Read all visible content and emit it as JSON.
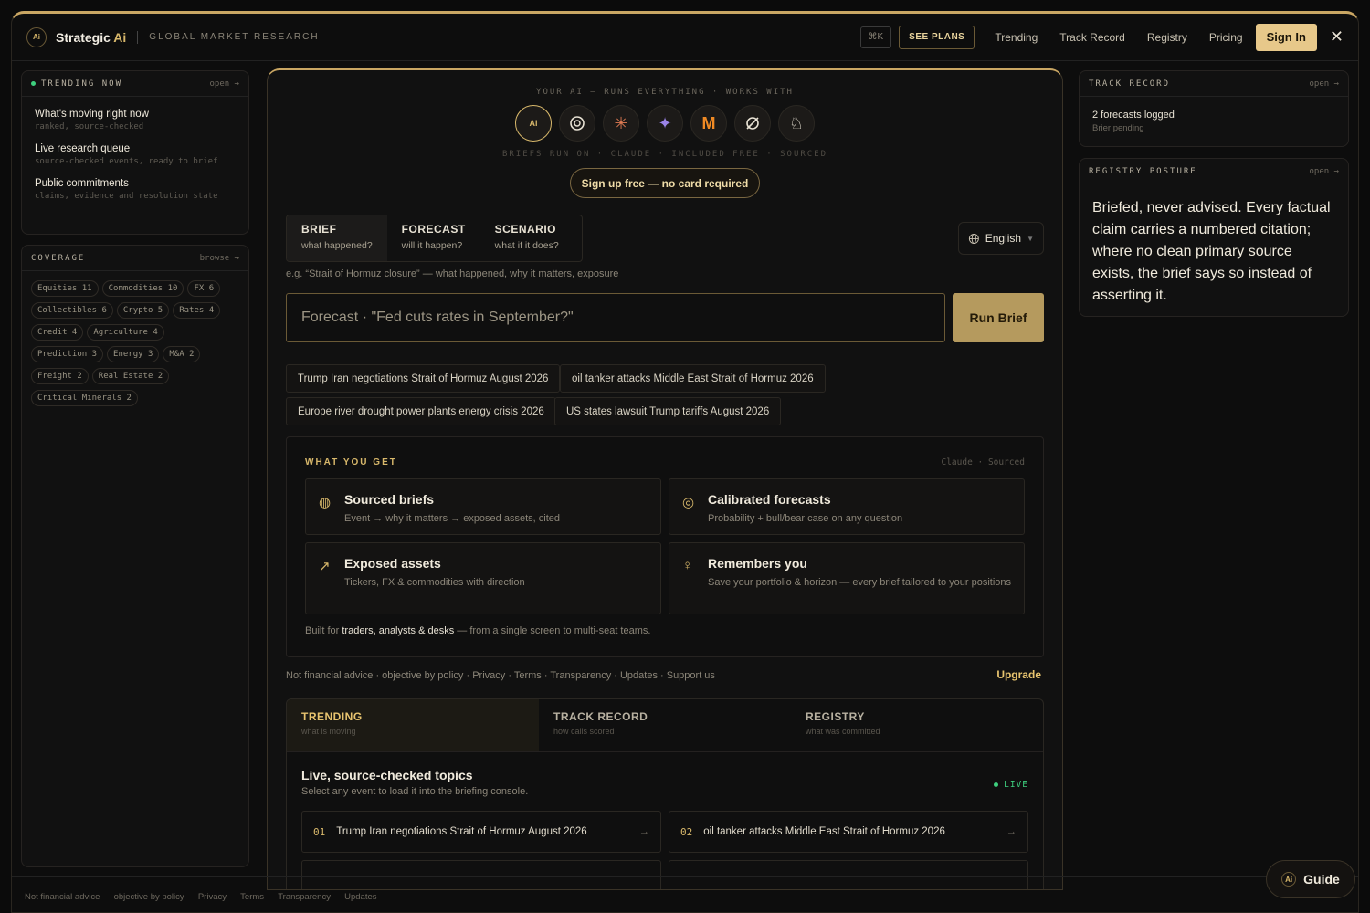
{
  "header": {
    "logo_text": "Ai",
    "brand_name": "Strategic",
    "brand_ai": "Ai",
    "tagline": "GLOBAL MARKET RESEARCH",
    "kbd": "⌘K",
    "see_plans": "SEE PLANS",
    "nav": [
      "Trending",
      "Track Record",
      "Registry",
      "Pricing"
    ],
    "sign_in": "Sign In",
    "close_icon": "close-icon"
  },
  "trending_now": {
    "title": "TRENDING NOW",
    "action": "open →",
    "items": [
      {
        "title": "What's moving right now",
        "sub": "ranked, source-checked"
      },
      {
        "title": "Live research queue",
        "sub": "source-checked events, ready to brief"
      },
      {
        "title": "Public commitments",
        "sub": "claims, evidence and resolution state"
      }
    ]
  },
  "coverage": {
    "title": "COVERAGE",
    "action": "browse →",
    "chips": [
      "Equities 11",
      "Commodities 10",
      "FX 6",
      "Collectibles 6",
      "Crypto 5",
      "Rates 4",
      "Credit 4",
      "Agriculture 4",
      "Prediction 3",
      "Energy 3",
      "M&A 2",
      "Freight 2",
      "Real Estate 2",
      "Critical Minerals 2"
    ]
  },
  "console": {
    "works_with": "YOUR AI — RUNS EVERYTHING · WORKS WITH",
    "model_icons": [
      "strategic-ai-icon",
      "openai-icon",
      "claude-icon",
      "gemini-icon",
      "mistral-icon",
      "grok-icon",
      "llama-icon"
    ],
    "runs_on": "BRIEFS RUN ON · CLAUDE · INCLUDED FREE · SOURCED",
    "signup": "Sign up free — no card required",
    "modes": [
      {
        "title": "BRIEF",
        "sub": "what happened?"
      },
      {
        "title": "FORECAST",
        "sub": "will it happen?"
      },
      {
        "title": "SCENARIO",
        "sub": "what if it does?"
      }
    ],
    "language": "English",
    "hint": "e.g. “Strait of Hormuz closure” — what happened, why it matters, exposure",
    "query_placeholder": "Forecast · \"Fed cuts rates in September?\"",
    "run_button": "Run Brief",
    "suggestions": [
      "Trump Iran negotiations Strait of Hormuz August 2026",
      "oil tanker attacks Middle East Strait of Hormuz 2026",
      "Europe river drought power plants energy crisis 2026",
      "US states lawsuit Trump tariffs August 2026"
    ]
  },
  "what_you_get": {
    "title": "WHAT YOU GET",
    "right": "Claude · Sourced",
    "features": [
      {
        "icon": "brain-icon",
        "title": "Sourced briefs",
        "sub": "Event → why it matters → exposed assets, cited"
      },
      {
        "icon": "target-icon",
        "title": "Calibrated forecasts",
        "sub": "Probability + bull/bear case on any question"
      },
      {
        "icon": "trend-up-icon",
        "title": "Exposed assets",
        "sub": "Tickers, FX & commodities with direction"
      },
      {
        "icon": "lightbulb-icon",
        "title": "Remembers you",
        "sub": "Save your portfolio & horizon — every brief tailored to your positions"
      }
    ],
    "built_prefix": "Built for ",
    "built_bold": "traders, analysts & desks",
    "built_suffix": " — from a single screen to multi-seat teams."
  },
  "footer_links": "Not financial advice · objective by policy · Privacy · Terms · Transparency · Updates · Support us",
  "upgrade": "Upgrade",
  "bottom_tabs": [
    {
      "title": "TRENDING",
      "sub": "what is moving"
    },
    {
      "title": "TRACK RECORD",
      "sub": "how calls scored"
    },
    {
      "title": "REGISTRY",
      "sub": "what was committed"
    }
  ],
  "live": {
    "title": "Live, source-checked topics",
    "sub": "Select any event to load it into the briefing console.",
    "badge": "LIVE",
    "rows": [
      {
        "num": "01",
        "text": "Trump Iran negotiations Strait of Hormuz August 2026"
      },
      {
        "num": "02",
        "text": "oil tanker attacks Middle East Strait of Hormuz 2026"
      }
    ]
  },
  "track_record": {
    "title": "TRACK RECORD",
    "action": "open →",
    "value": "2 forecasts logged",
    "sub": "Brier pending"
  },
  "registry": {
    "title": "REGISTRY POSTURE",
    "action": "open →",
    "text": "Briefed, never advised. Every factual claim carries a numbered citation; where no clean primary source exists, the brief says so instead of asserting it."
  },
  "bottom_bar": [
    "Not financial advice",
    "objective by policy",
    "Privacy",
    "Terms",
    "Transparency",
    "Updates"
  ],
  "guide": "Guide"
}
